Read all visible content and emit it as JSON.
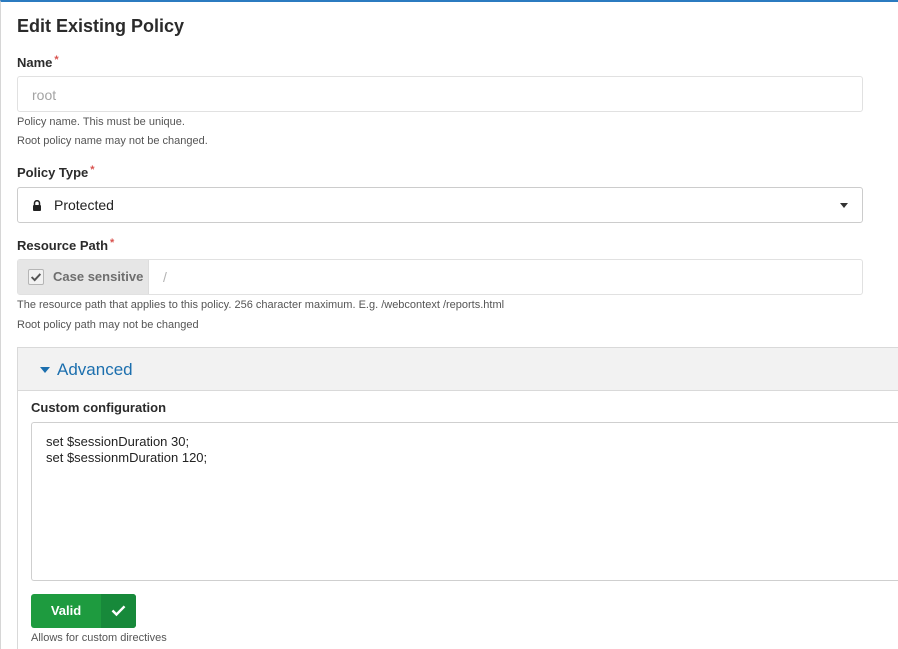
{
  "form": {
    "title": "Edit Existing Policy",
    "required_marker": "*"
  },
  "name_field": {
    "label": "Name",
    "value": "root",
    "help_lines": [
      "Policy name. This must be unique.",
      "Root policy name may not be changed."
    ]
  },
  "policy_type": {
    "label": "Policy Type",
    "selected": "Protected",
    "selected_icon": "lock-icon"
  },
  "resource_path": {
    "label": "Resource Path",
    "case_sensitive_label": "Case sensitive",
    "case_sensitive_checked": true,
    "value": "/",
    "help_lines": [
      "The resource path that applies to this policy. 256 character maximum. E.g. /webcontext /reports.html",
      "Root policy path may not be changed"
    ]
  },
  "advanced": {
    "title": "Advanced",
    "expanded": true,
    "custom_config_label": "Custom configuration",
    "custom_config_lines": [
      "set $sessionDuration 30;",
      "set $sessionmDuration 120;"
    ],
    "valid_button_label": "Valid",
    "valid_icon": "check-icon",
    "help": "Allows for custom directives"
  },
  "colors": {
    "accent": "#1c6fae",
    "required": "#d9534f",
    "valid": "#1e9b3f"
  }
}
